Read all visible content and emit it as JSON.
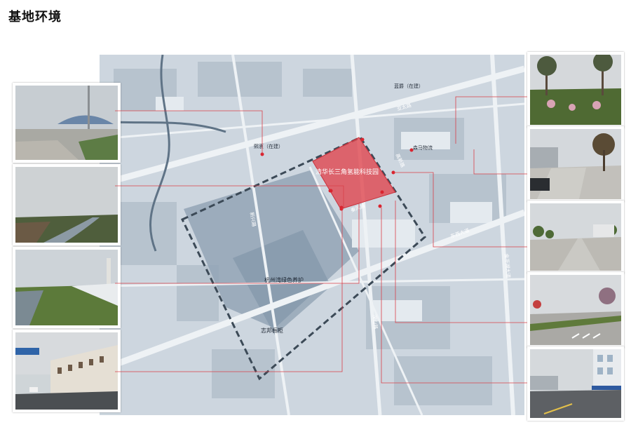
{
  "page": {
    "title": "基地环境"
  },
  "site": {
    "name": "清华长三角氢能科技园"
  },
  "places": {
    "lanyuan": "蓝爵（在建）",
    "xiyuan": "熙衷（在建）",
    "senma": "森马物流",
    "hangzhouwan": "杭州湾绿色养护",
    "zhibang": "志邦橱柜"
  },
  "roads": {
    "r1": "亚太路",
    "r2": "东西大道",
    "r3": "秦风路",
    "r4": "新兴路",
    "r5": "汉山路",
    "r6": "金平湖大道",
    "r7": "高新路"
  },
  "colors": {
    "site": "#e0464f",
    "leader": "#d9404a",
    "map": "#c9d3dc",
    "boundary": "#3c4a57"
  }
}
